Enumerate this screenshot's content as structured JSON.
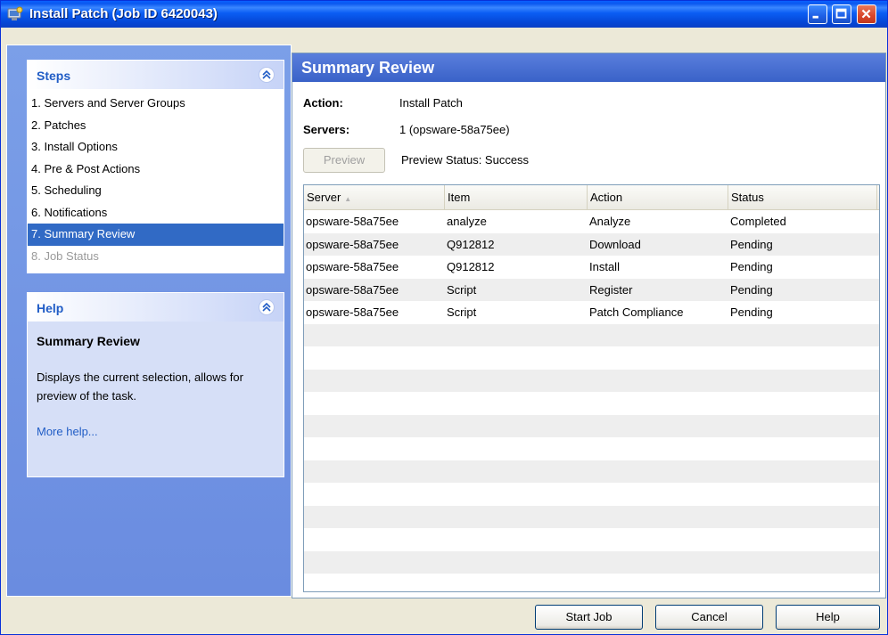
{
  "window": {
    "title": "Install Patch (Job ID 6420043)"
  },
  "steps": {
    "header": "Steps",
    "items": [
      {
        "label": "1. Servers and Server Groups",
        "state": "normal"
      },
      {
        "label": "2. Patches",
        "state": "normal"
      },
      {
        "label": "3. Install Options",
        "state": "normal"
      },
      {
        "label": "4. Pre & Post Actions",
        "state": "normal"
      },
      {
        "label": "5. Scheduling",
        "state": "normal"
      },
      {
        "label": "6. Notifications",
        "state": "normal"
      },
      {
        "label": "7. Summary Review",
        "state": "selected"
      },
      {
        "label": "8. Job Status",
        "state": "disabled"
      }
    ]
  },
  "help": {
    "header": "Help",
    "title": "Summary Review",
    "description": "Displays the current selection, allows for preview of the task.",
    "link": "More help..."
  },
  "main": {
    "title": "Summary Review",
    "action_label": "Action:",
    "action_value": "Install Patch",
    "servers_label": "Servers:",
    "servers_value": "1 (opsware-58a75ee)",
    "preview_button": "Preview",
    "preview_status": "Preview Status: Success"
  },
  "table": {
    "columns": [
      "Server",
      "Item",
      "Action",
      "Status"
    ],
    "rows": [
      [
        "opsware-58a75ee",
        "analyze",
        "Analyze",
        "Completed"
      ],
      [
        "opsware-58a75ee",
        "Q912812",
        "Download",
        "Pending"
      ],
      [
        "opsware-58a75ee",
        "Q912812",
        "Install",
        "Pending"
      ],
      [
        "opsware-58a75ee",
        "Script",
        "Register",
        "Pending"
      ],
      [
        "opsware-58a75ee",
        "Script",
        "Patch Compliance",
        "Pending"
      ]
    ]
  },
  "footer": {
    "start_job": "Start Job",
    "cancel": "Cancel",
    "help": "Help"
  }
}
